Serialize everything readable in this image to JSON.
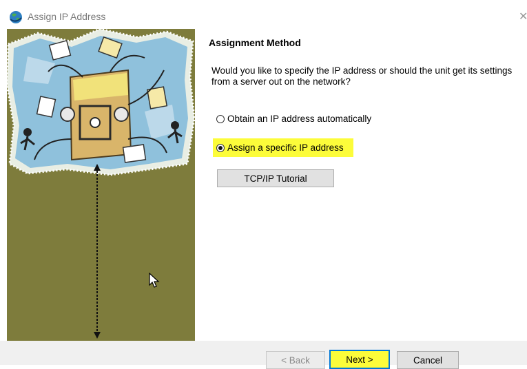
{
  "window": {
    "title": "Assign IP Address",
    "close_glyph": "✕"
  },
  "icons": {
    "app": "globe-icon",
    "close": "close-icon",
    "cursor": "mouse-pointer-icon"
  },
  "wizard": {
    "heading": "Assignment Method",
    "question": "Would you like to specify the IP address or should the unit get its settings from a server out on the network?",
    "options": [
      {
        "label": "Obtain an IP address automatically",
        "selected": false
      },
      {
        "label": "Assign a specific IP address",
        "selected": true
      }
    ],
    "tutorial_button": "TCP/IP Tutorial"
  },
  "footer": {
    "back_label": "< Back",
    "next_label": "Next >",
    "cancel_label": "Cancel"
  },
  "colors": {
    "highlight": "#fcfc3a",
    "side_panel": "#7e7c3c",
    "focus_border": "#0078d7"
  }
}
